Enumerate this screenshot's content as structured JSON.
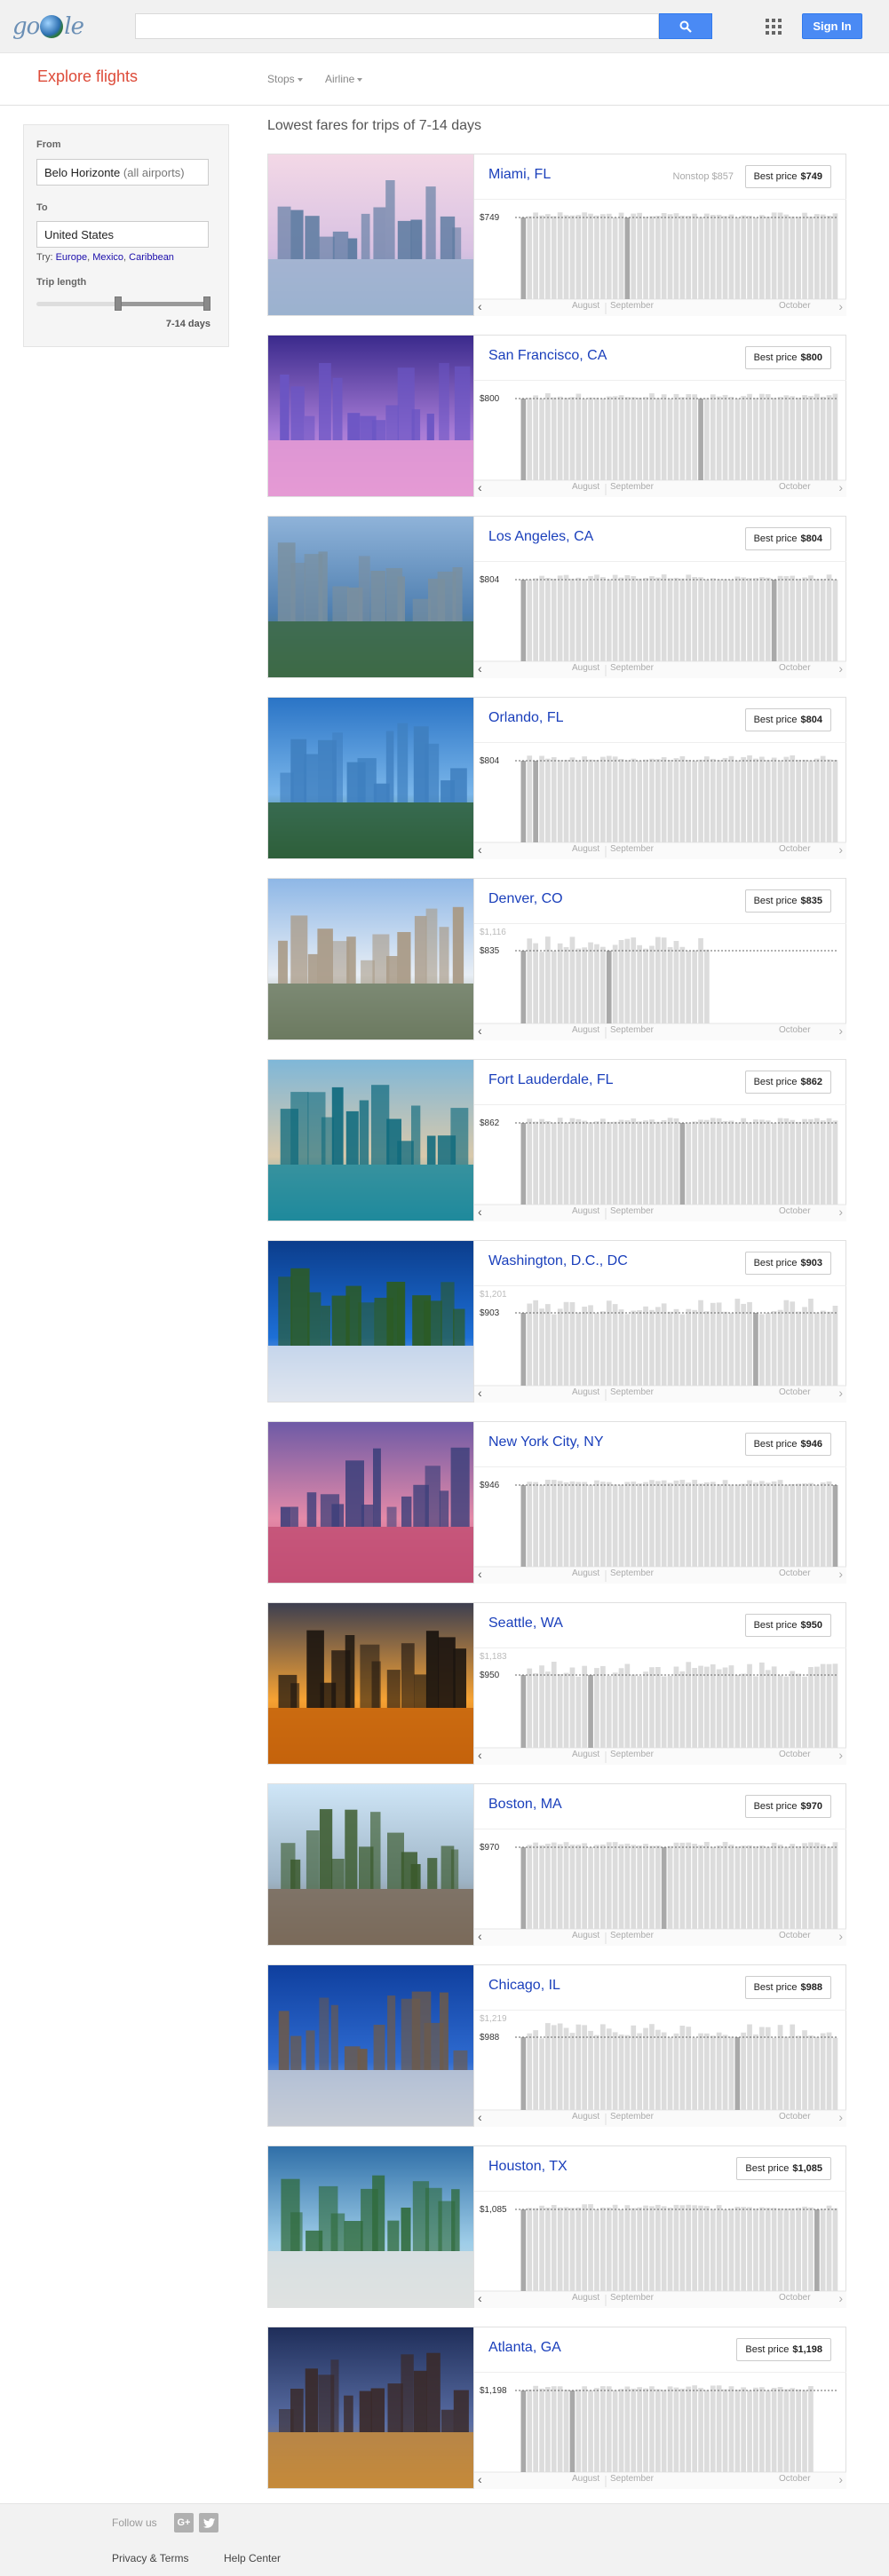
{
  "header": {
    "logo_text": "google",
    "search_placeholder": "",
    "sign_in_label": "Sign In"
  },
  "subnav": {
    "title": "Explore flights",
    "filters": [
      "Stops",
      "Airline"
    ]
  },
  "panel": {
    "from_label": "From",
    "from_value": "Belo Horizonte",
    "from_hint": "(all airports)",
    "to_label": "To",
    "to_value": "United States",
    "try_label": "Try:",
    "try_links": [
      "Europe",
      "Mexico",
      "Caribbean"
    ],
    "trip_length_label": "Trip length",
    "trip_length_value": "7-14 days"
  },
  "results": {
    "title": "Lowest fares for trips of 7-14 days",
    "best_price_label": "Best price",
    "months": [
      "August",
      "September",
      "October"
    ],
    "cards": [
      {
        "city": "Miami, FL",
        "price": "$749",
        "nonstop": "Nonstop $857",
        "max_label": "",
        "scene": "city-beach"
      },
      {
        "city": "San Francisco, CA",
        "price": "$800",
        "nonstop": "",
        "max_label": "",
        "scene": "bridge"
      },
      {
        "city": "Los Angeles, CA",
        "price": "$804",
        "nonstop": "",
        "max_label": "",
        "scene": "skyline-aerial"
      },
      {
        "city": "Orlando, FL",
        "price": "$804",
        "nonstop": "",
        "max_label": "",
        "scene": "lake"
      },
      {
        "city": "Denver, CO",
        "price": "$835",
        "nonstop": "",
        "max_label": "$1,116",
        "scene": "plaza"
      },
      {
        "city": "Fort Lauderdale, FL",
        "price": "$862",
        "nonstop": "",
        "max_label": "",
        "scene": "beach"
      },
      {
        "city": "Washington, D.C., DC",
        "price": "$903",
        "nonstop": "",
        "max_label": "$1,201",
        "scene": "capitol"
      },
      {
        "city": "New York City, NY",
        "price": "$946",
        "nonstop": "",
        "max_label": "",
        "scene": "dusk-skyline"
      },
      {
        "city": "Seattle, WA",
        "price": "$950",
        "nonstop": "",
        "max_label": "$1,183",
        "scene": "sunset"
      },
      {
        "city": "Boston, MA",
        "price": "$970",
        "nonstop": "",
        "max_label": "",
        "scene": "building"
      },
      {
        "city": "Chicago, IL",
        "price": "$988",
        "nonstop": "",
        "max_label": "$1,219",
        "scene": "tower"
      },
      {
        "city": "Houston, TX",
        "price": "$1,085",
        "nonstop": "",
        "max_label": "",
        "scene": "pool"
      },
      {
        "city": "Atlanta, GA",
        "price": "$1,198",
        "nonstop": "",
        "max_label": "",
        "scene": "highway"
      }
    ]
  },
  "footer": {
    "follow_label": "Follow us",
    "links": [
      "Privacy & Terms",
      "Help Center"
    ]
  },
  "colors": {
    "accent": "#dd4b39",
    "link": "#1a3fbb",
    "button": "#4a8af4"
  }
}
